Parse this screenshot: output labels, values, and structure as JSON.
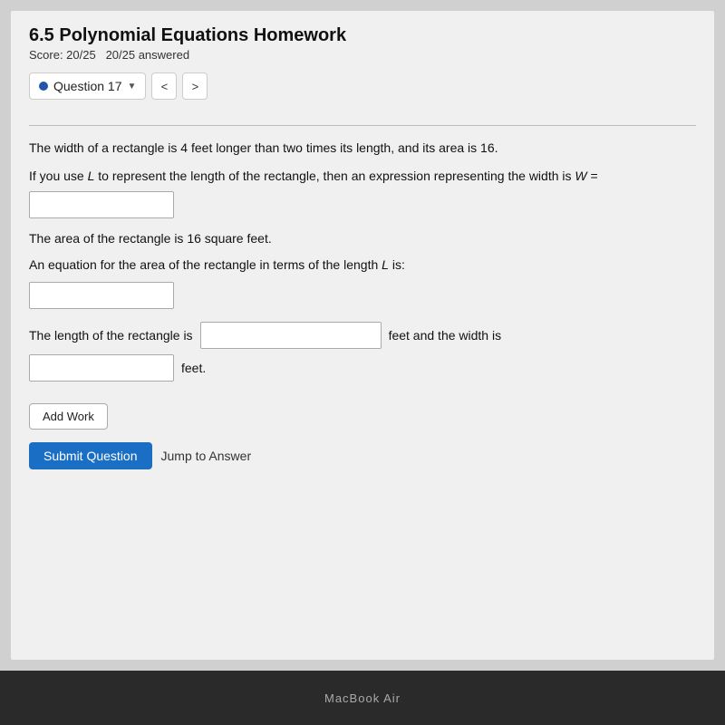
{
  "page": {
    "title": "6.5 Polynomial Equations Homework",
    "score_label": "Score: 20/25",
    "answered_label": "20/25 answered"
  },
  "question_nav": {
    "question_label": "Question 17",
    "prev_btn": "<",
    "next_btn": ">"
  },
  "problem": {
    "line1": "The width of a rectangle is 4 feet longer than two times its length, and its area is 16.",
    "line2_prefix": "If you use ",
    "line2_var1": "L",
    "line2_mid": " to represent the length of the rectangle, then an expression representing the width is ",
    "line2_var2": "W",
    "line2_suffix": " =",
    "input1_placeholder": "",
    "area_text": "The area of the rectangle is 16 square feet.",
    "equation_prefix": "An equation for the area of the rectangle in terms of the length ",
    "equation_var": "L",
    "equation_suffix": " is:",
    "input2_placeholder": "",
    "length_prefix": "The length of the rectangle is",
    "length_suffix": "feet and the width is",
    "width_suffix": "feet.",
    "input3_placeholder": "",
    "input4_placeholder": ""
  },
  "buttons": {
    "add_work": "Add Work",
    "submit": "Submit Question",
    "jump": "Jump to Answer"
  },
  "taskbar": {
    "label": "MacBook Air"
  }
}
